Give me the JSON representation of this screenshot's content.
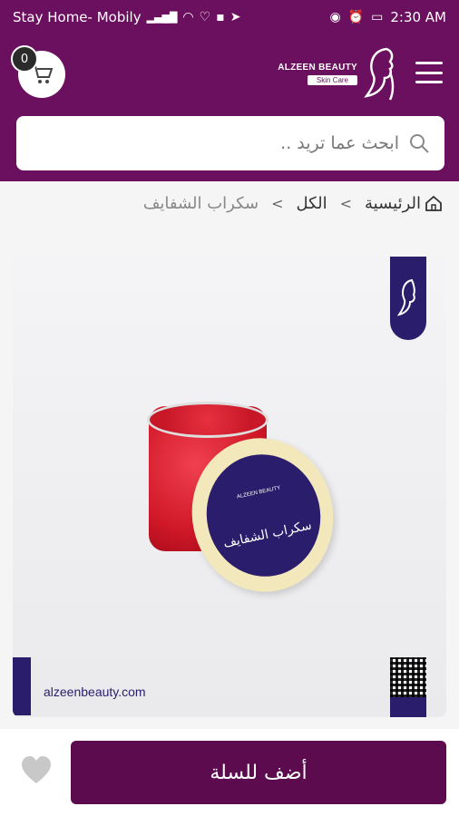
{
  "status_bar": {
    "carrier": "Stay Home- Mobily",
    "network": "4G",
    "time": "2:30 AM"
  },
  "header": {
    "cart_count": "0",
    "brand": "ALZEEN BEAUTY",
    "tagline": "Skin Care"
  },
  "search": {
    "placeholder": "ابحث عما تريد .."
  },
  "breadcrumb": {
    "home": "الرئيسية",
    "all": "الكل",
    "current": "سكراب الشفايف"
  },
  "product": {
    "lid_title": "سكراب الشفايف",
    "lid_brand": "ALZEEN BEAUTY",
    "website": "alzeenbeauty.com"
  },
  "actions": {
    "add_to_cart": "أضف للسلة"
  },
  "colors": {
    "brand_purple": "#6b0f5f",
    "button_purple": "#5c0b4f",
    "navy": "#2a1d6b"
  }
}
